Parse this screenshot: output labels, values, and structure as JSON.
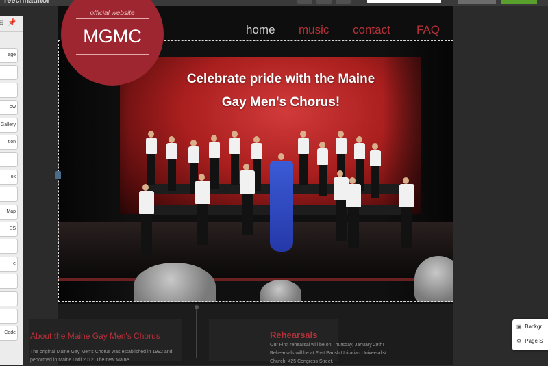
{
  "app": {
    "title": "reecnnaditor"
  },
  "left_panel": {
    "tools": [
      "⊞",
      "📌"
    ],
    "items": [
      "age",
      "",
      "",
      "ow",
      "Gallery",
      "tion",
      "",
      "ok",
      "",
      "Map",
      "SS",
      "",
      "e",
      "",
      "",
      "",
      "Code"
    ]
  },
  "site": {
    "nav": [
      {
        "label": "home",
        "color": "#cfcfcf"
      },
      {
        "label": "music",
        "color": "#b53139"
      },
      {
        "label": "contact",
        "color": "#b53139"
      },
      {
        "label": "FAQ",
        "color": "#b53139"
      }
    ],
    "logo": {
      "tagline": "official website",
      "name": "MGMC"
    },
    "hero": {
      "line1": "Celebrate pride with the Maine",
      "line2": "Gay Men's Chorus!"
    },
    "about": {
      "title": "About the Maine Gay Men's Chorus",
      "body": "The original Maine Gay Men's Chorus was established in 1992 and performed in Maine until 2012.  The new Maine"
    },
    "rehearsals": {
      "title": "Rehearsals",
      "body": "Our First rehearsal will be on Thursday, January 29th!  Rehearsals will be at First Parish Unitarian Universalist Church, 425 Congress Street,"
    }
  },
  "right_panel": {
    "items": [
      {
        "icon": "image-icon",
        "label": "Backgr"
      },
      {
        "icon": "gear-icon",
        "label": "Page S"
      }
    ]
  },
  "colors": {
    "accent": "#b53139",
    "logo": "#9e2630",
    "publish": "#5aa02c"
  }
}
